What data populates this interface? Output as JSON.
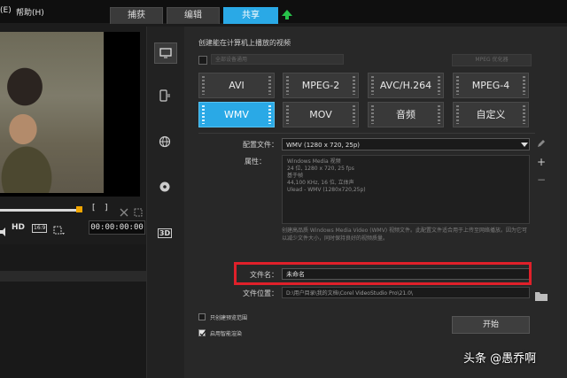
{
  "menu": {
    "partial_item": "(E)",
    "help": "帮助(H)"
  },
  "tabs": [
    {
      "label": "捕获",
      "active": false
    },
    {
      "label": "编辑",
      "active": false
    },
    {
      "label": "共享",
      "active": true
    }
  ],
  "preview": {
    "timecode": "00:00:00:00",
    "hd_label": "HD",
    "ratio_label": "16:9",
    "bracket_in": "[",
    "bracket_out": "]"
  },
  "sidenav": [
    {
      "icon": "monitor-icon",
      "active": true
    },
    {
      "icon": "device-icon",
      "active": false
    },
    {
      "icon": "globe-icon",
      "active": false
    },
    {
      "icon": "disc-icon",
      "active": false
    },
    {
      "icon": "3d-icon",
      "active": false,
      "label": "3D"
    }
  ],
  "main": {
    "title": "创建能在计算机上播放的视频",
    "disabled_dropdown": "全部设备通用",
    "disabled_option": "MPEG 优化器",
    "formats": [
      {
        "label": "AVI",
        "active": false
      },
      {
        "label": "MPEG-2",
        "active": false
      },
      {
        "label": "AVC/H.264",
        "active": false
      },
      {
        "label": "MPEG-4",
        "active": false
      },
      {
        "label": "WMV",
        "active": true
      },
      {
        "label": "MOV",
        "active": false
      },
      {
        "label": "音频",
        "active": false
      },
      {
        "label": "自定义",
        "active": false
      }
    ],
    "profile_label": "配置文件：",
    "profile_value": "WMV (1280 x 720, 25p)",
    "properties_label": "属性：",
    "properties": [
      "Windows Media 视频",
      "24 位, 1280 x 720, 25 fps",
      "基于帧",
      "44,100 KHz, 16 位, 立体声",
      "Ulead - WMV (1280x720,25p)"
    ],
    "description": "创建高品质 Windows Media Video (WMV) 视频文件。此配置文件适合用于上传至网络播放。因为它可以减少文件大小，同时保持良好的视频质量。",
    "filename_label": "文件名：",
    "filename_value": "未命名",
    "filepath_label": "文件位置：",
    "filepath_value": "D:\\用户目录\\我的文档\\Corel VideoStudio Pro\\21.0\\",
    "checkbox_preview_range": {
      "label": "只创建预览范围",
      "checked": false
    },
    "checkbox_smart_render": {
      "label": "启用智能渲染",
      "checked": true
    },
    "start_button": "开始"
  },
  "watermark": "头条 @愚乔啊",
  "colors": {
    "accent": "#2aa9e6",
    "highlight": "#e0202a",
    "upload_green": "#27c24a"
  }
}
